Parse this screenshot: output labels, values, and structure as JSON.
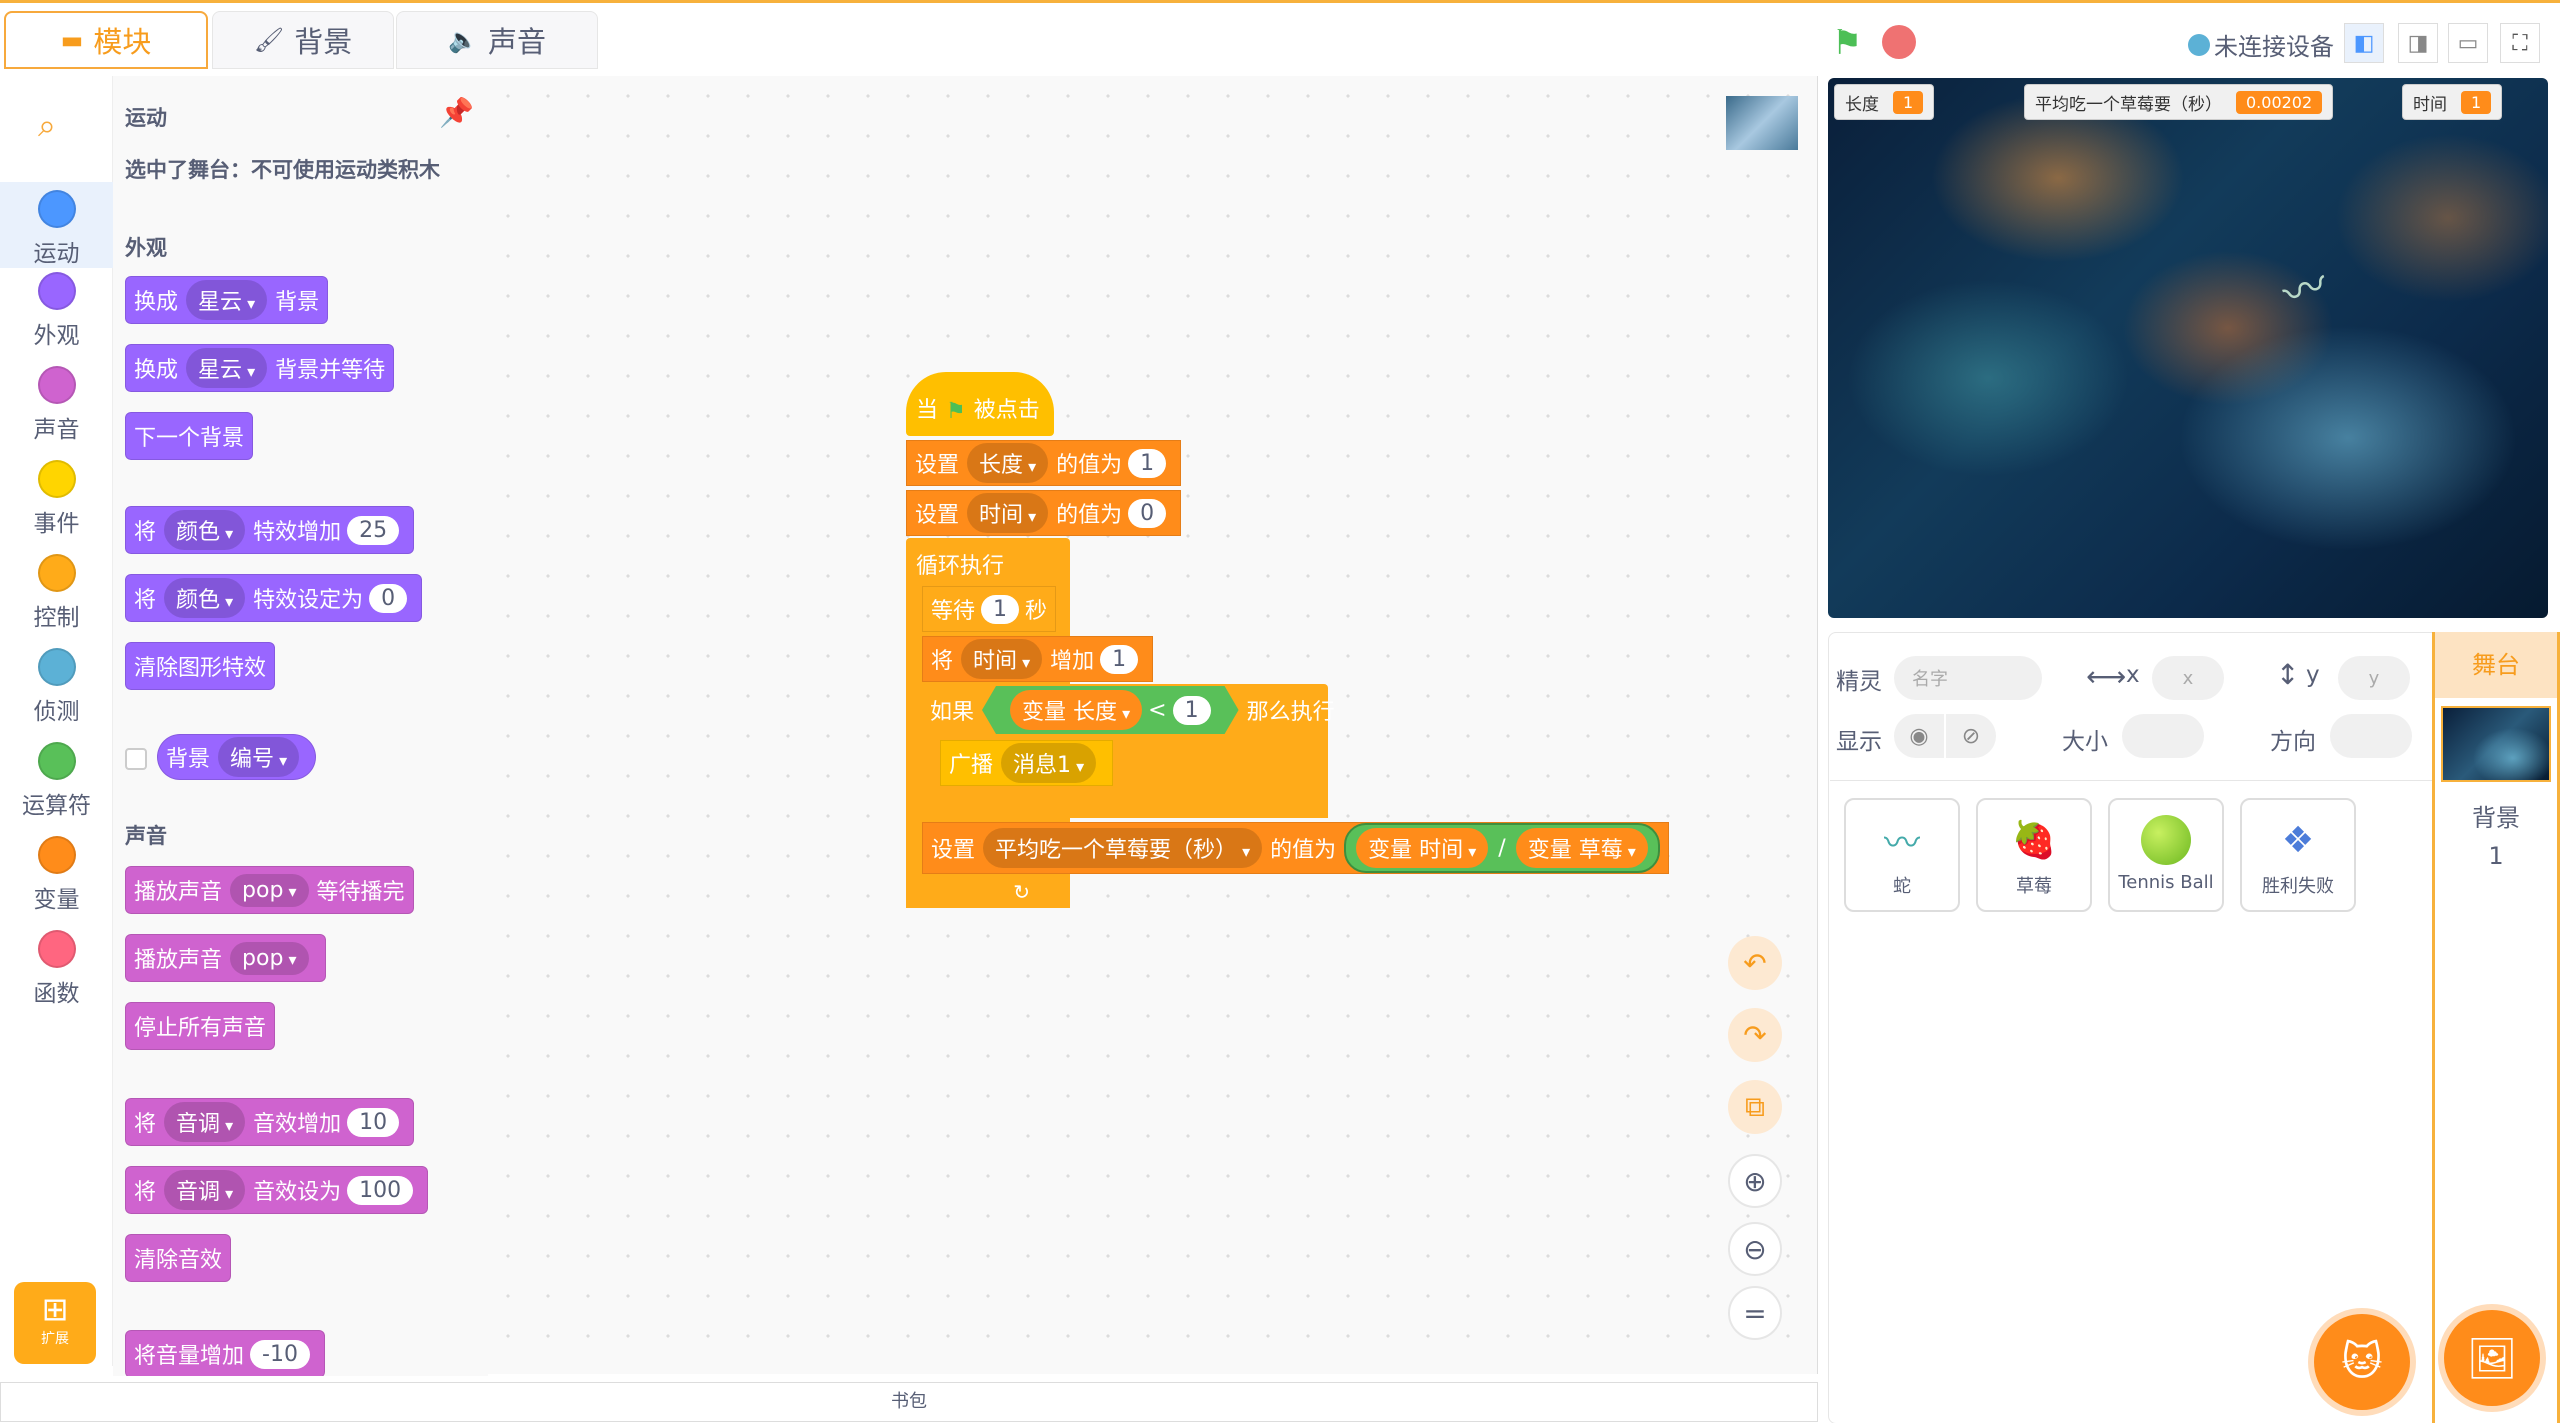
{
  "tabs": [
    {
      "label": "模块"
    },
    {
      "label": "背景"
    },
    {
      "label": "声音"
    }
  ],
  "header": {
    "connection": "未连接设备"
  },
  "categories": [
    {
      "label": "运动",
      "color": "#4c97ff"
    },
    {
      "label": "外观",
      "color": "#9966ff"
    },
    {
      "label": "声音",
      "color": "#cf63cf"
    },
    {
      "label": "事件",
      "color": "#ffd500"
    },
    {
      "label": "控制",
      "color": "#ffab19"
    },
    {
      "label": "侦测",
      "color": "#5cb1d6"
    },
    {
      "label": "运算符",
      "color": "#59c059"
    },
    {
      "label": "变量",
      "color": "#ff8c1a"
    },
    {
      "label": "函数",
      "color": "#ff6680"
    }
  ],
  "extension": {
    "label": "扩展"
  },
  "palette": {
    "motion_title": "运动",
    "motion_note": "选中了舞台：不可使用运动类积木",
    "looks_title": "外观",
    "sound_title": "声音",
    "b1": {
      "a": "换成",
      "d": "星云",
      "b": "背景"
    },
    "b2": {
      "a": "换成",
      "d": "星云",
      "b": "背景并等待"
    },
    "b3": "下一个背景",
    "b4": {
      "a": "将",
      "d": "颜色",
      "b": "特效增加",
      "v": "25"
    },
    "b5": {
      "a": "将",
      "d": "颜色",
      "b": "特效设定为",
      "v": "0"
    },
    "b6": "清除图形特效",
    "b7": {
      "a": "背景",
      "d": "编号"
    },
    "s1": {
      "a": "播放声音",
      "d": "pop",
      "b": "等待播完"
    },
    "s2": {
      "a": "播放声音",
      "d": "pop"
    },
    "s3": "停止所有声音",
    "s4": {
      "a": "将",
      "d": "音调",
      "b": "音效增加",
      "v": "10"
    },
    "s5": {
      "a": "将",
      "d": "音调",
      "b": "音效设为",
      "v": "100"
    },
    "s6": "清除音效",
    "s7": {
      "a": "将音量增加",
      "v": "-10"
    }
  },
  "script": {
    "hat": {
      "a": "当",
      "b": "被点击"
    },
    "set1": {
      "a": "设置",
      "d": "长度",
      "b": "的值为",
      "v": "1"
    },
    "set2": {
      "a": "设置",
      "d": "时间",
      "b": "的值为",
      "v": "0"
    },
    "forever": "循环执行",
    "wait": {
      "a": "等待",
      "v": "1",
      "b": "秒"
    },
    "change": {
      "a": "将",
      "d": "时间",
      "b": "增加",
      "v": "1"
    },
    "if": {
      "a": "如果",
      "var": "变量 长度",
      "op": "<",
      "v": "1",
      "b": "那么执行"
    },
    "broadcast": {
      "a": "广播",
      "d": "消息1"
    },
    "set3": {
      "a": "设置",
      "d": "平均吃一个草莓要（秒）",
      "b": "的值为",
      "v1": "变量 时间",
      "op": "/",
      "v2": "变量 草莓"
    }
  },
  "monitors": [
    {
      "label": "长度",
      "value": "1"
    },
    {
      "label": "平均吃一个草莓要（秒）",
      "value": "0.00202"
    },
    {
      "label": "时间",
      "value": "1"
    }
  ],
  "sprite_info": {
    "sprite_label": "精灵",
    "name_placeholder": "名字",
    "x_label": "x",
    "x_placeholder": "x",
    "y_label": "y",
    "y_placeholder": "y",
    "show_label": "显示",
    "size_label": "大小",
    "direction_label": "方向"
  },
  "sprites": [
    {
      "name": "蛇"
    },
    {
      "name": "草莓"
    },
    {
      "name": "Tennis Ball"
    },
    {
      "name": "胜利失败"
    }
  ],
  "stage_panel": {
    "title": "舞台",
    "backdrop_label": "背景",
    "backdrop_count": "1"
  },
  "backpack": "书包"
}
